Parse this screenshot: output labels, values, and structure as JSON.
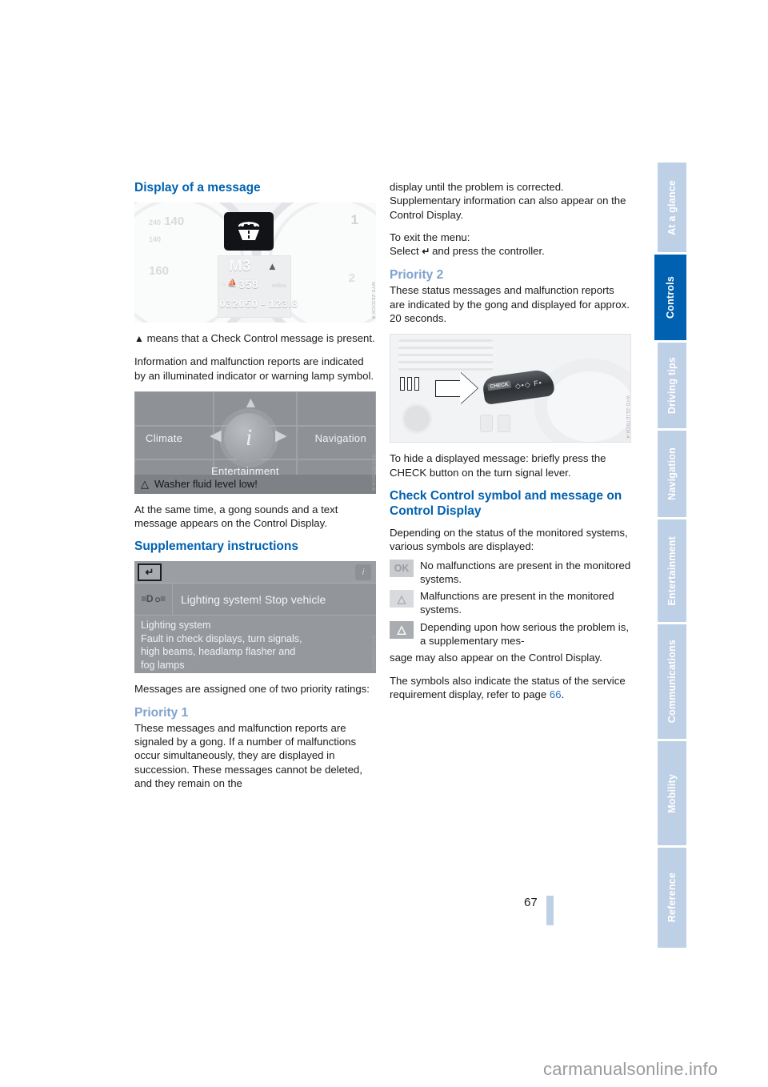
{
  "document": {
    "page_number": "67",
    "watermark": "carmanualsonline.info"
  },
  "sidebar": {
    "items": [
      {
        "label": "At a glance",
        "active": false
      },
      {
        "label": "Controls",
        "active": true
      },
      {
        "label": "Driving tips",
        "active": false
      },
      {
        "label": "Navigation",
        "active": false
      },
      {
        "label": "Entertainment",
        "active": false
      },
      {
        "label": "Communications",
        "active": false
      },
      {
        "label": "Mobility",
        "active": false
      },
      {
        "label": "Reference",
        "active": false
      }
    ],
    "active_color": "#0061b0",
    "inactive_color": "#bed0e6"
  },
  "left_column": {
    "heading": "Display of a message",
    "figure_cluster": {
      "code": "WYD-ZE2DCM-A",
      "gear": "M3",
      "range_value": "358",
      "range_unit": "miles",
      "odometer": "032050 - 123.8",
      "speed_ticks": [
        "240",
        "140",
        "140",
        "160"
      ],
      "tach_ticks": [
        "1",
        "2"
      ],
      "warning_lamp": "washer-fluid-symbol",
      "check_control_triangle": "warning-triangle"
    },
    "paragraph_1": "means that a Check Control message is present.",
    "paragraph_2": "Information and malfunction reports are indicated by an illuminated indicator or warning lamp symbol.",
    "figure_idrive": {
      "code": "BYD-ZE3DCM-B",
      "left_label": "Climate",
      "right_label": "Navigation",
      "bottom_label": "Entertainment",
      "center_icon": "info-icon",
      "status_message": "Washer fluid level low!",
      "status_icon": "warning-triangle-icon"
    },
    "paragraph_3": "At the same time, a gong sounds and a text message appears on the Control Display.",
    "heading_2": "Supplementary instructions",
    "figure_control_display": {
      "code": "BYD-ZE5DABW",
      "back_button_icon": "back-arrow-icon",
      "info_button_icon": "info-icon",
      "message_icon": "lighting-system-icon",
      "message_title": "Lighting system! Stop vehicle",
      "detail_line_1": "Lighting system",
      "detail_line_2": "Fault in check displays, turn signals,",
      "detail_line_3": "high beams, headlamp flasher and",
      "detail_line_4": "fog lamps"
    },
    "paragraph_4": "Messages are assigned one of two priority ratings:",
    "heading_3": "Priority 1",
    "paragraph_5": "These messages and malfunction reports are signaled by a gong. If a number of malfunctions occur simultaneously, they are displayed in succession. These messages cannot be deleted, and they remain on the"
  },
  "right_column": {
    "paragraph_1": "display until the problem is corrected. Supplementary information can also appear on the Control Display.",
    "paragraph_2_line1": "To exit the menu:",
    "paragraph_2_line2_pre": "Select",
    "paragraph_2_line2_post": "and press the controller.",
    "heading_1": "Priority 2",
    "paragraph_3": "These status messages and malfunction reports are indicated by the gong and displayed for approx. 20 seconds.",
    "figure_lever": {
      "code": "WYD-ZE1E7DCM-A",
      "button_label": "CHECK",
      "description": "turn-signal-lever-with-check-button"
    },
    "paragraph_4": "To hide a displayed message: briefly press the CHECK button on the turn signal lever.",
    "heading_2": "Check Control symbol and message on Control Display",
    "paragraph_5": "Depending on the status of the monitored systems, various symbols are displayed:",
    "symbols": [
      {
        "glyph": "OK",
        "style": "ok",
        "text": "No malfunctions are present in the monitored systems."
      },
      {
        "glyph": "△",
        "style": "tri-light",
        "text": "Malfunctions are present in the monitored systems."
      },
      {
        "glyph": "△",
        "style": "tri-dark",
        "text": "Depending upon how serious the problem is, a supplementary mes-"
      }
    ],
    "paragraph_6": "sage may also appear on the Control Display.",
    "paragraph_7_pre": "The symbols also indicate the status of the service requirement display, refer to page",
    "paragraph_7_link": "66",
    "paragraph_7_post": "."
  },
  "colors": {
    "heading_blue": "#0061b0",
    "subheading_blue": "#7fa2cd",
    "link_blue": "#2f74c0",
    "body_text": "#1a1a1a"
  }
}
